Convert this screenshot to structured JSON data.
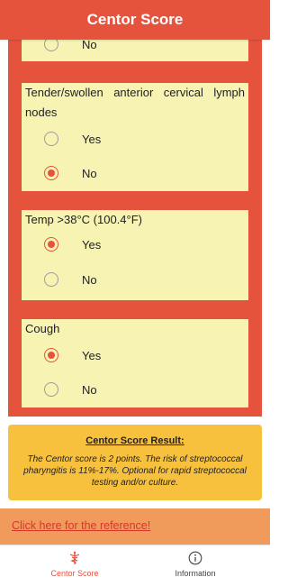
{
  "header": {
    "title": "Centor Score"
  },
  "questions": [
    {
      "title": "",
      "options": [
        {
          "label": "No",
          "checked": false
        }
      ]
    },
    {
      "title": "Tender/swollen anterior cervical lymph nodes",
      "options": [
        {
          "label": "Yes",
          "checked": false
        },
        {
          "label": "No",
          "checked": true
        }
      ]
    },
    {
      "title": "Temp >38°C (100.4°F)",
      "options": [
        {
          "label": "Yes",
          "checked": true
        },
        {
          "label": "No",
          "checked": false
        }
      ]
    },
    {
      "title": "Cough",
      "options": [
        {
          "label": "Yes",
          "checked": true
        },
        {
          "label": "No",
          "checked": false
        }
      ]
    }
  ],
  "result": {
    "title": "Centor Score Result:",
    "text": "The Centor score is 2 points. The risk of streptococcal pharyngitis is 11%-17%. Optional for rapid streptococcal testing and/or culture."
  },
  "reference": {
    "link_text": "Click here for the reference!"
  },
  "tabs": [
    {
      "label": "Centor Score",
      "icon": "caduceus-icon",
      "active": true
    },
    {
      "label": "Information",
      "icon": "info-icon",
      "active": false
    }
  ],
  "colors": {
    "primary": "#e5533d",
    "card": "#f7f3b2",
    "result": "#f7c03d",
    "reference_bar": "#f09a5c"
  }
}
